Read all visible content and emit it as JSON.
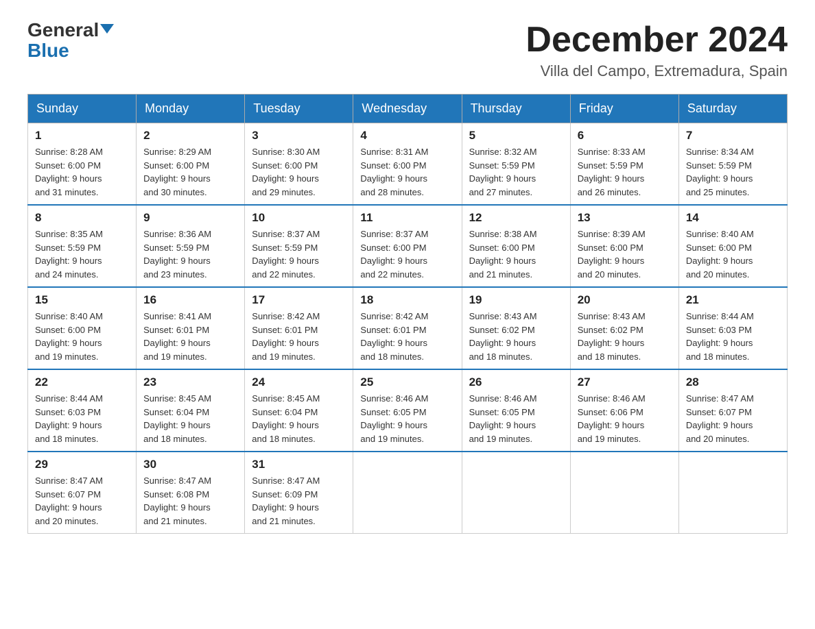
{
  "logo": {
    "general": "General",
    "blue": "Blue"
  },
  "title": "December 2024",
  "subtitle": "Villa del Campo, Extremadura, Spain",
  "weekdays": [
    "Sunday",
    "Monday",
    "Tuesday",
    "Wednesday",
    "Thursday",
    "Friday",
    "Saturday"
  ],
  "weeks": [
    [
      {
        "day": "1",
        "sunrise": "8:28 AM",
        "sunset": "6:00 PM",
        "daylight": "9 hours and 31 minutes."
      },
      {
        "day": "2",
        "sunrise": "8:29 AM",
        "sunset": "6:00 PM",
        "daylight": "9 hours and 30 minutes."
      },
      {
        "day": "3",
        "sunrise": "8:30 AM",
        "sunset": "6:00 PM",
        "daylight": "9 hours and 29 minutes."
      },
      {
        "day": "4",
        "sunrise": "8:31 AM",
        "sunset": "6:00 PM",
        "daylight": "9 hours and 28 minutes."
      },
      {
        "day": "5",
        "sunrise": "8:32 AM",
        "sunset": "5:59 PM",
        "daylight": "9 hours and 27 minutes."
      },
      {
        "day": "6",
        "sunrise": "8:33 AM",
        "sunset": "5:59 PM",
        "daylight": "9 hours and 26 minutes."
      },
      {
        "day": "7",
        "sunrise": "8:34 AM",
        "sunset": "5:59 PM",
        "daylight": "9 hours and 25 minutes."
      }
    ],
    [
      {
        "day": "8",
        "sunrise": "8:35 AM",
        "sunset": "5:59 PM",
        "daylight": "9 hours and 24 minutes."
      },
      {
        "day": "9",
        "sunrise": "8:36 AM",
        "sunset": "5:59 PM",
        "daylight": "9 hours and 23 minutes."
      },
      {
        "day": "10",
        "sunrise": "8:37 AM",
        "sunset": "5:59 PM",
        "daylight": "9 hours and 22 minutes."
      },
      {
        "day": "11",
        "sunrise": "8:37 AM",
        "sunset": "6:00 PM",
        "daylight": "9 hours and 22 minutes."
      },
      {
        "day": "12",
        "sunrise": "8:38 AM",
        "sunset": "6:00 PM",
        "daylight": "9 hours and 21 minutes."
      },
      {
        "day": "13",
        "sunrise": "8:39 AM",
        "sunset": "6:00 PM",
        "daylight": "9 hours and 20 minutes."
      },
      {
        "day": "14",
        "sunrise": "8:40 AM",
        "sunset": "6:00 PM",
        "daylight": "9 hours and 20 minutes."
      }
    ],
    [
      {
        "day": "15",
        "sunrise": "8:40 AM",
        "sunset": "6:00 PM",
        "daylight": "9 hours and 19 minutes."
      },
      {
        "day": "16",
        "sunrise": "8:41 AM",
        "sunset": "6:01 PM",
        "daylight": "9 hours and 19 minutes."
      },
      {
        "day": "17",
        "sunrise": "8:42 AM",
        "sunset": "6:01 PM",
        "daylight": "9 hours and 19 minutes."
      },
      {
        "day": "18",
        "sunrise": "8:42 AM",
        "sunset": "6:01 PM",
        "daylight": "9 hours and 18 minutes."
      },
      {
        "day": "19",
        "sunrise": "8:43 AM",
        "sunset": "6:02 PM",
        "daylight": "9 hours and 18 minutes."
      },
      {
        "day": "20",
        "sunrise": "8:43 AM",
        "sunset": "6:02 PM",
        "daylight": "9 hours and 18 minutes."
      },
      {
        "day": "21",
        "sunrise": "8:44 AM",
        "sunset": "6:03 PM",
        "daylight": "9 hours and 18 minutes."
      }
    ],
    [
      {
        "day": "22",
        "sunrise": "8:44 AM",
        "sunset": "6:03 PM",
        "daylight": "9 hours and 18 minutes."
      },
      {
        "day": "23",
        "sunrise": "8:45 AM",
        "sunset": "6:04 PM",
        "daylight": "9 hours and 18 minutes."
      },
      {
        "day": "24",
        "sunrise": "8:45 AM",
        "sunset": "6:04 PM",
        "daylight": "9 hours and 18 minutes."
      },
      {
        "day": "25",
        "sunrise": "8:46 AM",
        "sunset": "6:05 PM",
        "daylight": "9 hours and 19 minutes."
      },
      {
        "day": "26",
        "sunrise": "8:46 AM",
        "sunset": "6:05 PM",
        "daylight": "9 hours and 19 minutes."
      },
      {
        "day": "27",
        "sunrise": "8:46 AM",
        "sunset": "6:06 PM",
        "daylight": "9 hours and 19 minutes."
      },
      {
        "day": "28",
        "sunrise": "8:47 AM",
        "sunset": "6:07 PM",
        "daylight": "9 hours and 20 minutes."
      }
    ],
    [
      {
        "day": "29",
        "sunrise": "8:47 AM",
        "sunset": "6:07 PM",
        "daylight": "9 hours and 20 minutes."
      },
      {
        "day": "30",
        "sunrise": "8:47 AM",
        "sunset": "6:08 PM",
        "daylight": "9 hours and 21 minutes."
      },
      {
        "day": "31",
        "sunrise": "8:47 AM",
        "sunset": "6:09 PM",
        "daylight": "9 hours and 21 minutes."
      },
      null,
      null,
      null,
      null
    ]
  ],
  "labels": {
    "sunrise": "Sunrise:",
    "sunset": "Sunset:",
    "daylight": "Daylight:"
  }
}
